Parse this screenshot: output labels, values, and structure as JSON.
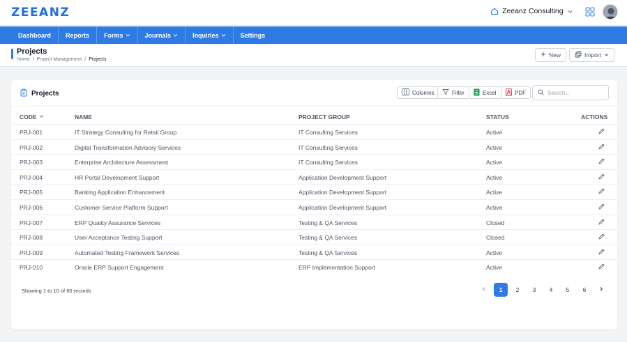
{
  "brand": {
    "logo": "ZEEANZ",
    "accent": "#2f7be5"
  },
  "header": {
    "company": "Zeeanz Consulting"
  },
  "nav": [
    {
      "label": "Dashboard",
      "dropdown": false
    },
    {
      "label": "Reports",
      "dropdown": false
    },
    {
      "label": "Forms",
      "dropdown": true
    },
    {
      "label": "Journals",
      "dropdown": true
    },
    {
      "label": "Inquiries",
      "dropdown": true
    },
    {
      "label": "Settings",
      "dropdown": false
    }
  ],
  "page": {
    "title": "Projects",
    "breadcrumb": [
      "Home",
      "/",
      "Project Management",
      "/",
      "Projects"
    ],
    "new_label": "New",
    "import_label": "Import"
  },
  "card": {
    "title": "Projects",
    "columns_label": "Columns",
    "filter_label": "Filter",
    "excel_label": "Excel",
    "pdf_label": "PDF",
    "search_placeholder": "Search..."
  },
  "table": {
    "headers": [
      "CODE",
      "NAME",
      "PROJECT GROUP",
      "STATUS",
      "ACTIONS"
    ],
    "rows": [
      [
        "PRJ-001",
        "IT Strategy Consulting for Retail Group",
        "IT Consulting Services",
        "Active"
      ],
      [
        "PRJ-002",
        "Digital Transformation Advisory Services",
        "IT Consulting Services",
        "Active"
      ],
      [
        "PRJ-003",
        "Enterprise Architecture Assessment",
        "IT Consulting Services",
        "Active"
      ],
      [
        "PRJ-004",
        "HR Portal Development Support",
        "Application Development Support",
        "Active"
      ],
      [
        "PRJ-005",
        "Banking Application Enhancement",
        "Application Development Support",
        "Active"
      ],
      [
        "PRJ-006",
        "Customer Service Platform Support",
        "Application Development Support",
        "Active"
      ],
      [
        "PRJ-007",
        "ERP Quality Assurance Services",
        "Testing & QA Services",
        "Closed"
      ],
      [
        "PRJ-008",
        "User Acceptance Testing Support",
        "Testing & QA Services",
        "Closed"
      ],
      [
        "PRJ-009",
        "Automated Testing Framework Services",
        "Testing & QA Services",
        "Active"
      ],
      [
        "PRJ-010",
        "Oracle ERP Support Engagement",
        "ERP Implementation Support",
        "Active"
      ]
    ]
  },
  "footer": {
    "records": "Showing 1 to 10 of 60 records",
    "pages": [
      "1",
      "2",
      "3",
      "4",
      "5",
      "6"
    ],
    "current_page": "1"
  }
}
